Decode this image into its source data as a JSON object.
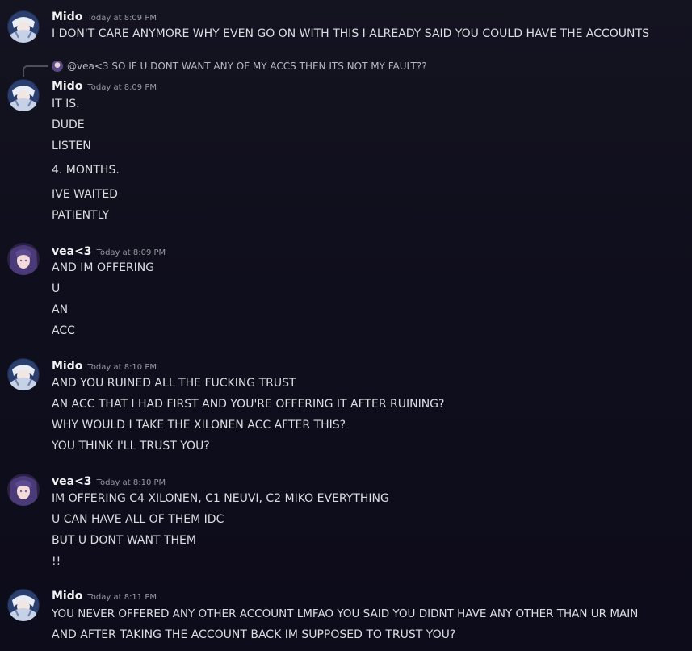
{
  "messages": [
    {
      "author": "Mido",
      "timestamp": "Today at 8:09 PM",
      "lines": [
        "I DON'T CARE ANYMORE WHY EVEN GO ON WITH THIS I ALREADY SAID YOU COULD HAVE THE ACCOUNTS"
      ]
    },
    {
      "author": "Mido",
      "timestamp": "Today at 8:09 PM",
      "reply": {
        "mention": "@vea<3",
        "text": "SO IF U DONT WANT ANY OF MY ACCS THEN ITS NOT MY FAULT??"
      },
      "lines": [
        "IT IS.",
        "DUDE",
        "LISTEN",
        "4. MONTHS.",
        "IVE WAITED",
        "PATIENTLY"
      ]
    },
    {
      "author": "vea<3",
      "timestamp": "Today at 8:09 PM",
      "lines": [
        "AND IM OFFERING",
        "U",
        "AN",
        "ACC"
      ]
    },
    {
      "author": "Mido",
      "timestamp": "Today at 8:10 PM",
      "lines": [
        "AND YOU RUINED ALL THE FUCKING TRUST",
        "AN ACC THAT I HAD FIRST AND YOU'RE OFFERING IT AFTER RUINING?",
        "WHY WOULD I TAKE THE XILONEN ACC AFTER THIS?",
        "YOU THINK I'LL TRUST YOU?"
      ]
    },
    {
      "author": "vea<3",
      "timestamp": "Today at 8:10 PM",
      "lines": [
        "IM OFFERING C4 XILONEN, C1 NEUVI, C2 MIKO EVERYTHING",
        "U CAN HAVE ALL OF THEM IDC",
        "BUT U DONT WANT THEM",
        "!!"
      ]
    },
    {
      "author": "Mido",
      "timestamp": "Today at 8:11 PM",
      "lines": [
        "YOU NEVER OFFERED ANY OTHER ACCOUNT LMFAO YOU SAID YOU DIDNT HAVE ANY OTHER THAN UR MAIN",
        "AND AFTER TAKING THE ACCOUNT BACK IM SUPPOSED TO TRUST YOU?"
      ]
    }
  ]
}
